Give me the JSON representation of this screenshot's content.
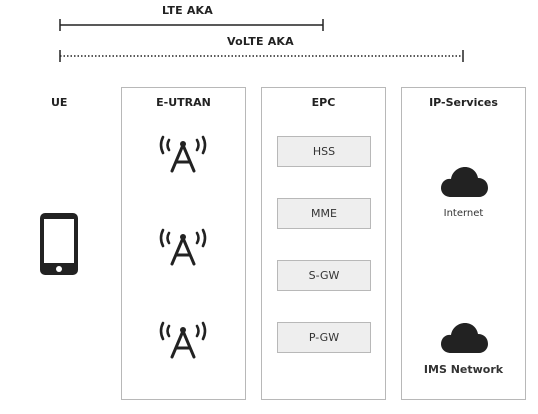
{
  "ranges": {
    "lte_aka": "LTE AKA",
    "volte_aka": "VoLTE AKA"
  },
  "ue": {
    "label": "UE"
  },
  "eutran": {
    "title": "E-UTRAN"
  },
  "epc": {
    "title": "EPC",
    "nodes": [
      "HSS",
      "MME",
      "S-GW",
      "P-GW"
    ]
  },
  "ip_services": {
    "title": "IP-Services",
    "internet": "Internet",
    "ims": "IMS Network"
  }
}
